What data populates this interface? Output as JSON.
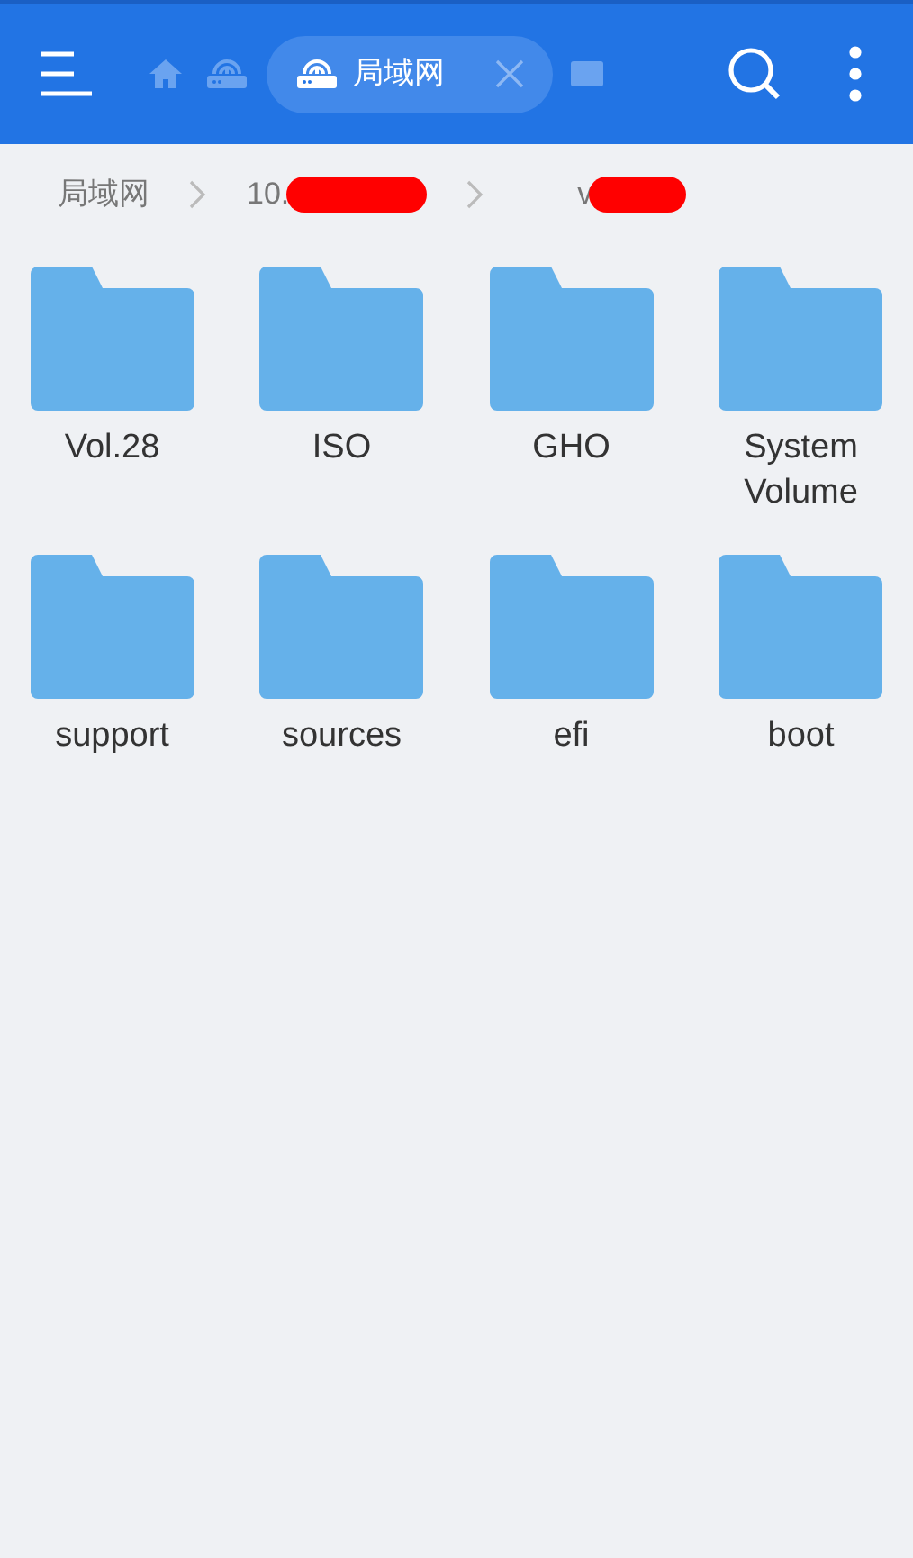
{
  "toolbar": {
    "tabs": [
      {
        "kind": "home",
        "selected": false
      },
      {
        "kind": "network",
        "selected": false
      },
      {
        "kind": "network",
        "label": "局域网",
        "selected": true
      },
      {
        "kind": "storage",
        "selected": false
      }
    ]
  },
  "breadcrumb": [
    {
      "label": "局域网",
      "redacted": false
    },
    {
      "label": "10.",
      "redacted": true
    },
    {
      "label": "v",
      "redacted": true
    }
  ],
  "folders": [
    {
      "name": "Vol.28"
    },
    {
      "name": "ISO"
    },
    {
      "name": "GHO"
    },
    {
      "name": "System Volume"
    },
    {
      "name": "support"
    },
    {
      "name": "sources"
    },
    {
      "name": "efi"
    },
    {
      "name": "boot"
    }
  ]
}
